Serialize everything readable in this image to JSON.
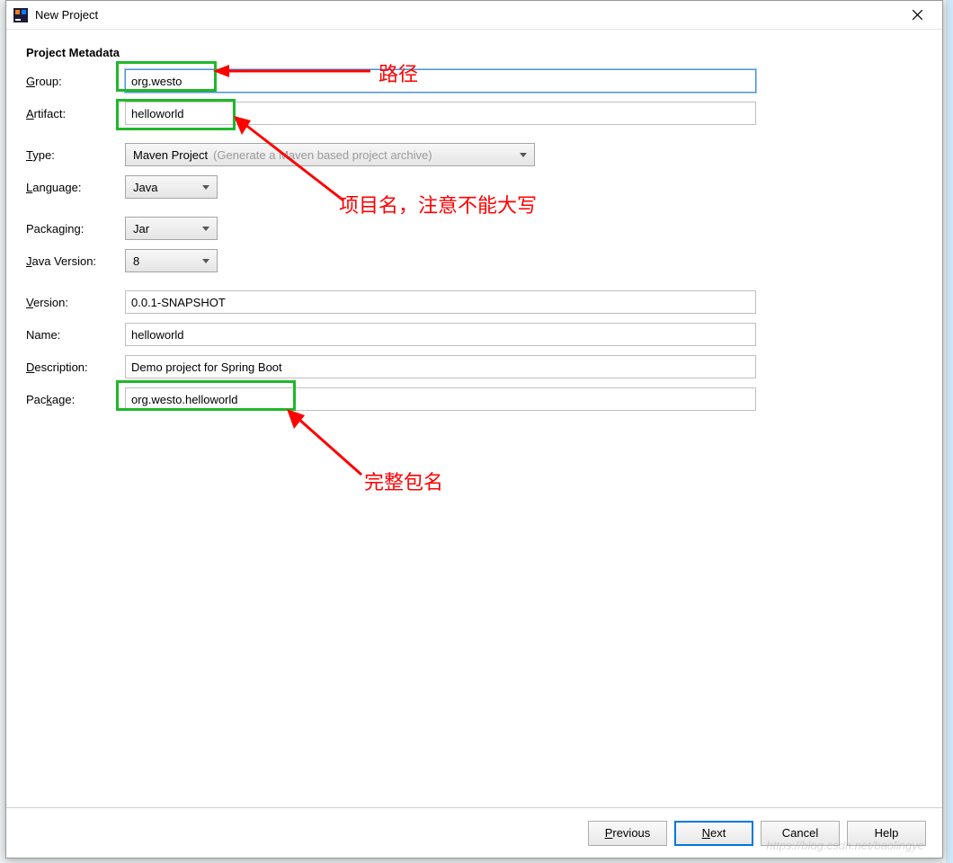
{
  "window": {
    "title": "New Project"
  },
  "section": {
    "title": "Project Metadata"
  },
  "labels": {
    "group": "Group:",
    "artifact": "Artifact:",
    "type": "Type:",
    "language": "Language:",
    "packaging": "Packaging:",
    "javaVersion": "Java Version:",
    "version": "Version:",
    "name": "Name:",
    "description": "Description:",
    "package": "Package:"
  },
  "mnemonics": {
    "group": "G",
    "artifact": "A",
    "type": "T",
    "language": "L",
    "packaging": "P",
    "javaVersion": "J",
    "version": "V",
    "name": "N",
    "description": "D",
    "package": "k"
  },
  "values": {
    "group": "org.westo",
    "artifact": "helloworld",
    "type": "Maven Project",
    "typeHint": "(Generate a Maven based project archive)",
    "language": "Java",
    "packaging": "Jar",
    "javaVersion": "8",
    "version": "0.0.1-SNAPSHOT",
    "name": "helloworld",
    "description": "Demo project for Spring Boot",
    "package": "org.westo.helloworld"
  },
  "buttons": {
    "previous": "Previous",
    "next": "Next",
    "cancel": "Cancel",
    "help": "Help"
  },
  "annotations": {
    "path": "路径",
    "projectName": "项目名，注意不能大写",
    "fullPackage": "完整包名"
  },
  "watermark": "https://blog.csdn.net/baolingye"
}
